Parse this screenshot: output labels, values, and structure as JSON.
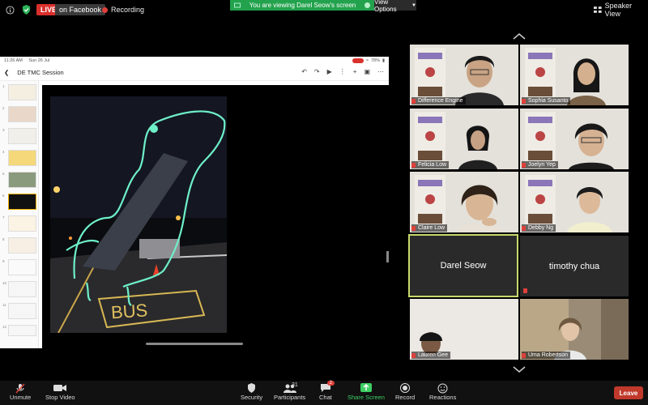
{
  "top": {
    "live_label": "LIVE",
    "live_target": "on Facebook",
    "recording_label": "Recording",
    "viewing_banner": "You are viewing Darel Seow's screen",
    "view_options_label": "View Options",
    "speaker_view_label": "Speaker View"
  },
  "share": {
    "status_time": "11:26 AM",
    "status_date": "Sun 26 Jul",
    "status_battery": "78%",
    "doc_title": "DE TMC Session",
    "slide_numbers": [
      "1",
      "2",
      "3",
      "4",
      "5",
      "6",
      "7",
      "8",
      "9",
      "10",
      "11",
      "12"
    ],
    "photo_text": "BUS"
  },
  "participants": [
    {
      "name": "Difference Engine"
    },
    {
      "name": "Sophia Susanto"
    },
    {
      "name": "Felicia Low"
    },
    {
      "name": "Joelyn Yep"
    },
    {
      "name": "Claire Low"
    },
    {
      "name": "Debby Ng"
    },
    {
      "name": "Darel Seow"
    },
    {
      "name": "timothy chua"
    },
    {
      "name": "Lauren Gee"
    },
    {
      "name": "Uma Robertson"
    }
  ],
  "toolbar": {
    "unmute": "Unmute",
    "stop_video": "Stop Video",
    "security": "Security",
    "participants": "Participants",
    "participants_count": "31",
    "chat": "Chat",
    "chat_badge": "2",
    "share_screen": "Share Screen",
    "record": "Record",
    "reactions": "Reactions",
    "leave": "Leave"
  },
  "colors": {
    "live_red": "#d9302c",
    "banner_green": "#23a24d",
    "active_speaker_border": "#c8d96b",
    "leave_red": "#c0392b",
    "sketch_cyan": "#6ef0c9"
  }
}
